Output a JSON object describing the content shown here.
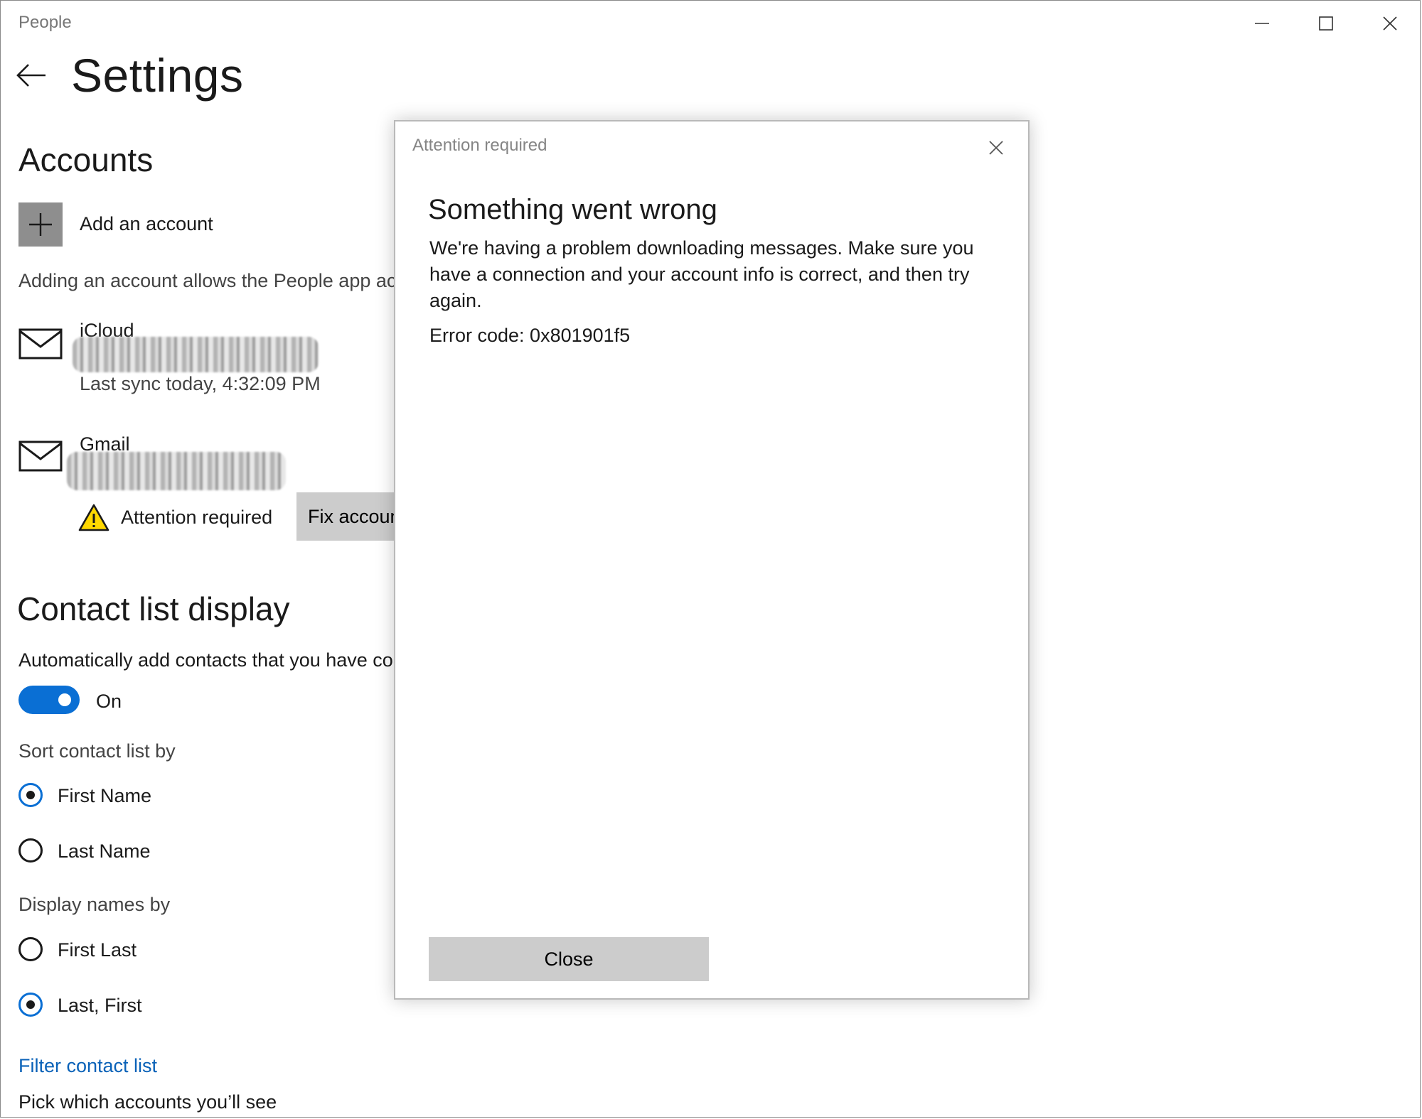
{
  "window": {
    "app_title": "People",
    "controls": {
      "minimize_icon": "minimize-icon",
      "maximize_icon": "maximize-icon",
      "close_icon": "close-icon"
    }
  },
  "page": {
    "title": "Settings",
    "back_icon": "back-arrow-icon"
  },
  "accounts": {
    "heading": "Accounts",
    "add_label": "Add an account",
    "description": "Adding an account allows the People app ac",
    "items": [
      {
        "name": "iCloud",
        "status": "Last sync today, 4:32:09 PM",
        "icon": "mail-icon"
      },
      {
        "name": "Gmail",
        "warning": "Attention required",
        "fix_button": "Fix account",
        "icon": "mail-icon"
      }
    ]
  },
  "contact_display": {
    "heading": "Contact list display",
    "auto_add_label": "Automatically add contacts that you have co",
    "toggle_state": "On",
    "toggle_on": true,
    "sort_label": "Sort contact list by",
    "sort_options": [
      {
        "label": "First Name",
        "checked": true
      },
      {
        "label": "Last Name",
        "checked": false
      }
    ],
    "display_label": "Display names by",
    "display_options": [
      {
        "label": "First Last",
        "checked": false
      },
      {
        "label": "Last, First",
        "checked": true
      }
    ],
    "filter_link": "Filter contact list",
    "filter_desc": "Pick which accounts you’ll see"
  },
  "dialog": {
    "caption": "Attention required",
    "heading": "Something went wrong",
    "message": "We're having a problem downloading messages. Make sure you have a connection and your account info is correct, and then try again.",
    "error": "Error code: 0x801901f5",
    "close_button": "Close"
  },
  "colors": {
    "accent": "#0a6fd4",
    "link": "#0a62b8",
    "button_gray": "#cccccc",
    "warning_yellow": "#ffd800"
  }
}
